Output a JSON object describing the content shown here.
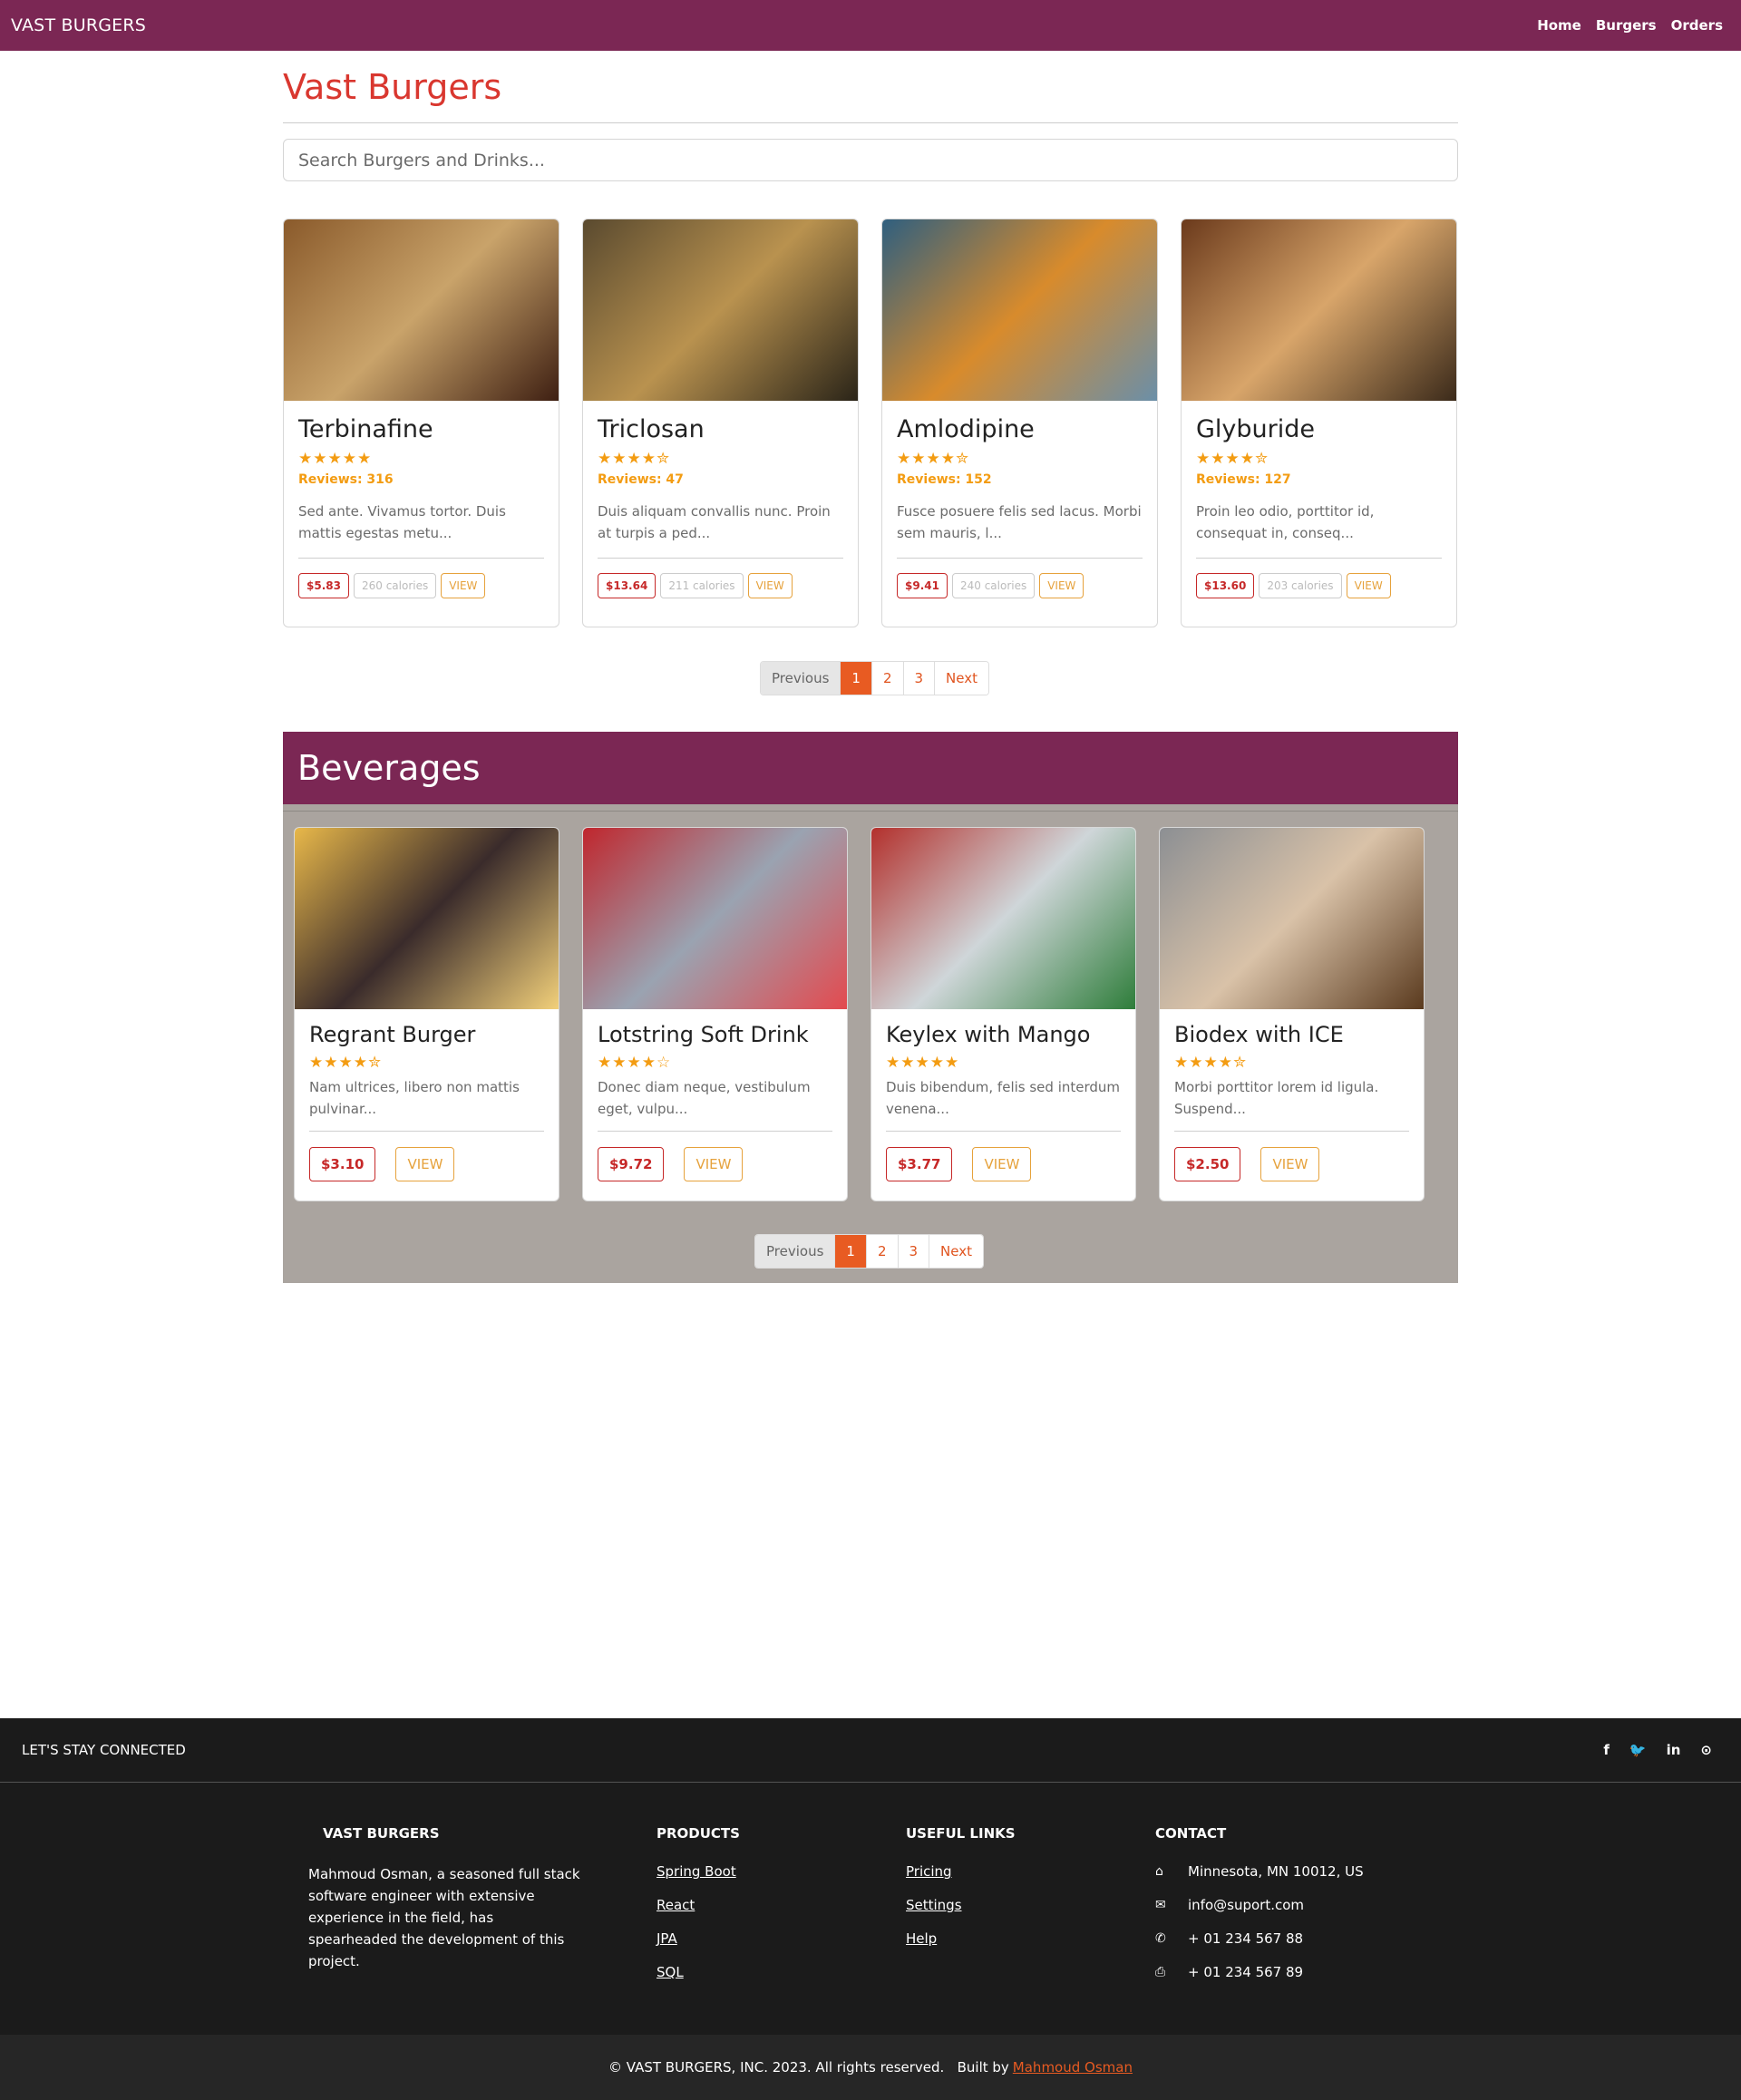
{
  "navbar": {
    "brand": "VAST BURGERS",
    "links": [
      "Home",
      "Burgers",
      "Orders"
    ]
  },
  "header": {
    "title": "Vast Burgers"
  },
  "search": {
    "placeholder": "Search Burgers and Drinks..."
  },
  "burgers": [
    {
      "name": "Terbinafine",
      "stars": "★★★★★",
      "reviews": "Reviews: 316",
      "desc": "Sed ante. Vivamus tortor. Duis mattis egestas metu...",
      "price": "$5.83",
      "calories": "260 calories",
      "view": "VIEW",
      "image_colors": [
        "#8a5a2b",
        "#c9a36a",
        "#3e1f12"
      ]
    },
    {
      "name": "Triclosan",
      "stars": "★★★★✮",
      "reviews": "Reviews: 47",
      "desc": "Duis aliquam convallis nunc. Proin at turpis a ped...",
      "price": "$13.64",
      "calories": "211 calories",
      "view": "VIEW",
      "image_colors": [
        "#5a4a2f",
        "#b9924f",
        "#2a2418"
      ]
    },
    {
      "name": "Amlodipine",
      "stars": "★★★★✮",
      "reviews": "Reviews: 152",
      "desc": "Fusce posuere felis sed lacus. Morbi sem mauris, l...",
      "price": "$9.41",
      "calories": "240 calories",
      "view": "VIEW",
      "image_colors": [
        "#2f5f7f",
        "#d88b2c",
        "#6b8fa8"
      ]
    },
    {
      "name": "Glyburide",
      "stars": "★★★★✮",
      "reviews": "Reviews: 127",
      "desc": "Proin leo odio, porttitor id, consequat in, conseq...",
      "price": "$13.60",
      "calories": "203 calories",
      "view": "VIEW",
      "image_colors": [
        "#6b3a1c",
        "#d8a56a",
        "#3b2a1a"
      ]
    }
  ],
  "pagination": {
    "prev": "Previous",
    "pages": [
      "1",
      "2",
      "3"
    ],
    "next": "Next",
    "active": "1"
  },
  "beverages": {
    "title": "Beverages",
    "items": [
      {
        "name": "Regrant Burger",
        "stars": "★★★★✮",
        "desc": "Nam ultrices, libero non mattis pulvinar...",
        "price": "$3.10",
        "view": "VIEW",
        "image_colors": [
          "#e8b84a",
          "#3a2b2b",
          "#f2d07a"
        ]
      },
      {
        "name": "Lotstring Soft Drink",
        "stars": "★★★★☆",
        "desc": "Donec diam neque, vestibulum eget, vulpu...",
        "price": "$9.72",
        "view": "VIEW",
        "image_colors": [
          "#c0262d",
          "#9aa3b1",
          "#e34a4f"
        ]
      },
      {
        "name": "Keylex with Mango",
        "stars": "★★★★★",
        "desc": "Duis bibendum, felis sed interdum venena...",
        "price": "$3.77",
        "view": "VIEW",
        "image_colors": [
          "#b3302c",
          "#cfd6d9",
          "#2e7d3a"
        ]
      },
      {
        "name": "Biodex with ICE",
        "stars": "★★★★✮",
        "desc": "Morbi porttitor lorem id ligula. Suspend...",
        "price": "$2.50",
        "view": "VIEW",
        "image_colors": [
          "#8c8f93",
          "#d9c2a8",
          "#5a3a1e"
        ]
      }
    ]
  },
  "footer": {
    "stay": "LET'S STAY CONNECTED",
    "socials": [
      "f",
      "t",
      "in",
      "gh"
    ],
    "brand_heading": "VAST BURGERS",
    "about": "Mahmoud Osman, a seasoned full stack software engineer with extensive experience in the field, has spearheaded the development of this project.",
    "products_heading": "PRODUCTS",
    "products": [
      "Spring Boot",
      "React",
      "JPA",
      "SQL"
    ],
    "useful_heading": "USEFUL LINKS",
    "useful": [
      "Pricing",
      "Settings",
      "Help"
    ],
    "contact_heading": "CONTACT",
    "contact": [
      {
        "icon": "home-icon",
        "text": "Minnesota, MN 10012, US"
      },
      {
        "icon": "envelope-icon",
        "text": "info@suport.com"
      },
      {
        "icon": "phone-icon",
        "text": "+ 01 234 567 88"
      },
      {
        "icon": "printer-icon",
        "text": "+ 01 234 567 89"
      }
    ],
    "copyright": "© VAST BURGERS, INC. 2023. All rights reserved.   Built by",
    "author": "Mahmoud Osman"
  },
  "colors": {
    "brand": "#7b2754",
    "accent": "#e85b22",
    "title": "#d9372f",
    "star": "#f39c12"
  }
}
